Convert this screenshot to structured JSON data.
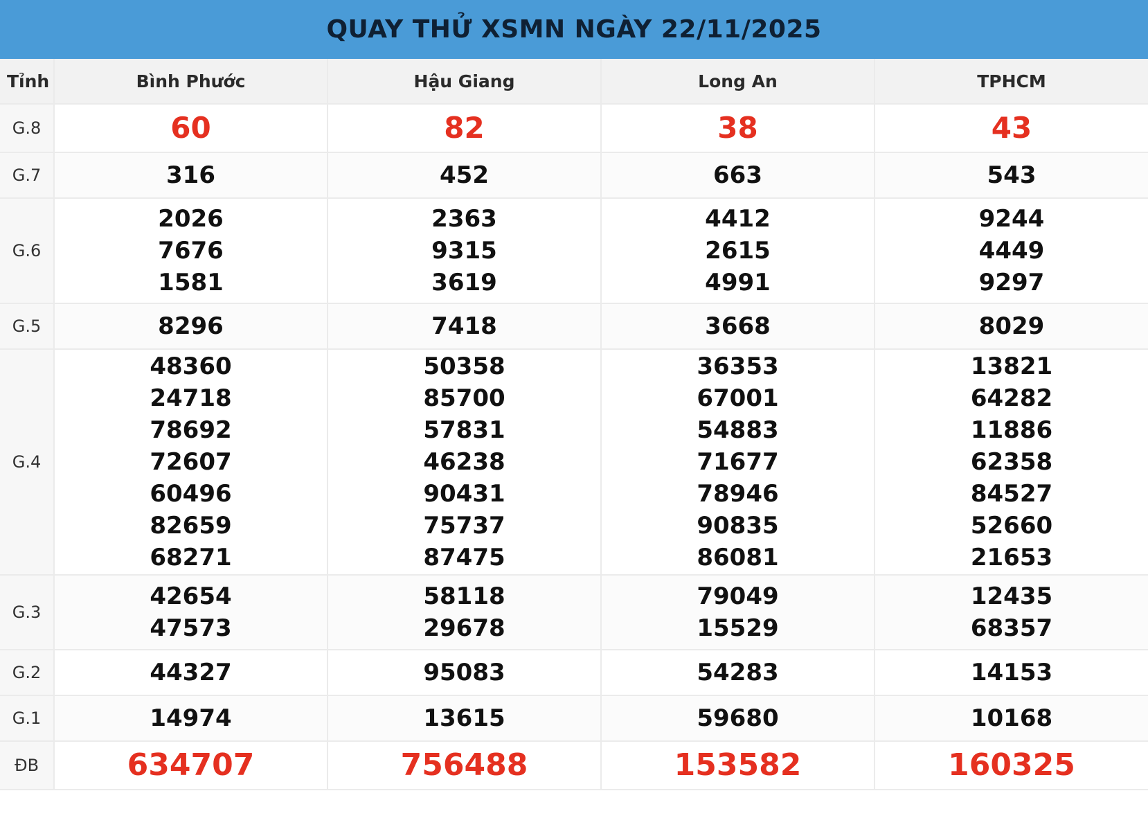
{
  "title": "QUAY THỬ XSMN NGÀY 22/11/2025",
  "header": {
    "label": "Tỉnh",
    "provinces": [
      "Bình Phước",
      "Hậu Giang",
      "Long An",
      "TPHCM"
    ]
  },
  "colors": {
    "title_bg": "#4a9bd7",
    "highlight": "#e53020",
    "text": "#111111"
  },
  "prizes": [
    {
      "label": "G.8",
      "cols": [
        [
          "60"
        ],
        [
          "82"
        ],
        [
          "38"
        ],
        [
          "43"
        ]
      ]
    },
    {
      "label": "G.7",
      "cols": [
        [
          "316"
        ],
        [
          "452"
        ],
        [
          "663"
        ],
        [
          "543"
        ]
      ]
    },
    {
      "label": "G.6",
      "cols": [
        [
          "2026",
          "7676",
          "1581"
        ],
        [
          "2363",
          "9315",
          "3619"
        ],
        [
          "4412",
          "2615",
          "4991"
        ],
        [
          "9244",
          "4449",
          "9297"
        ]
      ]
    },
    {
      "label": "G.5",
      "cols": [
        [
          "8296"
        ],
        [
          "7418"
        ],
        [
          "3668"
        ],
        [
          "8029"
        ]
      ]
    },
    {
      "label": "G.4",
      "cols": [
        [
          "48360",
          "24718",
          "78692",
          "72607",
          "60496",
          "82659",
          "68271"
        ],
        [
          "50358",
          "85700",
          "57831",
          "46238",
          "90431",
          "75737",
          "87475"
        ],
        [
          "36353",
          "67001",
          "54883",
          "71677",
          "78946",
          "90835",
          "86081"
        ],
        [
          "13821",
          "64282",
          "11886",
          "62358",
          "84527",
          "52660",
          "21653"
        ]
      ]
    },
    {
      "label": "G.3",
      "cols": [
        [
          "42654",
          "47573"
        ],
        [
          "58118",
          "29678"
        ],
        [
          "79049",
          "15529"
        ],
        [
          "12435",
          "68357"
        ]
      ]
    },
    {
      "label": "G.2",
      "cols": [
        [
          "44327"
        ],
        [
          "95083"
        ],
        [
          "54283"
        ],
        [
          "14153"
        ]
      ]
    },
    {
      "label": "G.1",
      "cols": [
        [
          "14974"
        ],
        [
          "13615"
        ],
        [
          "59680"
        ],
        [
          "10168"
        ]
      ]
    },
    {
      "label": "ĐB",
      "cols": [
        [
          "634707"
        ],
        [
          "756488"
        ],
        [
          "153582"
        ],
        [
          "160325"
        ]
      ]
    }
  ]
}
